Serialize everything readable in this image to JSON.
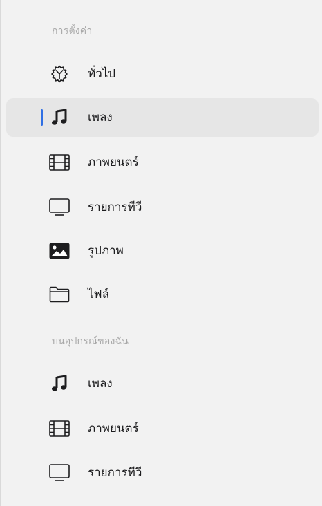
{
  "settings_section": {
    "header": "การตั้งค่า",
    "items": [
      {
        "label": "ทั่วไป",
        "icon": "gear-icon"
      },
      {
        "label": "เพลง",
        "icon": "music-note-icon",
        "selected": true
      },
      {
        "label": "ภาพยนตร์",
        "icon": "film-icon"
      },
      {
        "label": "รายการทีวี",
        "icon": "tv-icon"
      },
      {
        "label": "รูปภาพ",
        "icon": "photo-icon"
      },
      {
        "label": "ไฟล์",
        "icon": "folder-icon"
      }
    ]
  },
  "device_section": {
    "header": "บนอุปกรณ์ของฉัน",
    "items": [
      {
        "label": "เพลง",
        "icon": "music-note-icon"
      },
      {
        "label": "ภาพยนตร์",
        "icon": "film-icon"
      },
      {
        "label": "รายการทีวี",
        "icon": "tv-icon"
      }
    ]
  },
  "colors": {
    "selection_indicator": "#2f6fe4",
    "selected_row_bg": "#e6e6e6",
    "section_header": "#a8a8a8"
  }
}
